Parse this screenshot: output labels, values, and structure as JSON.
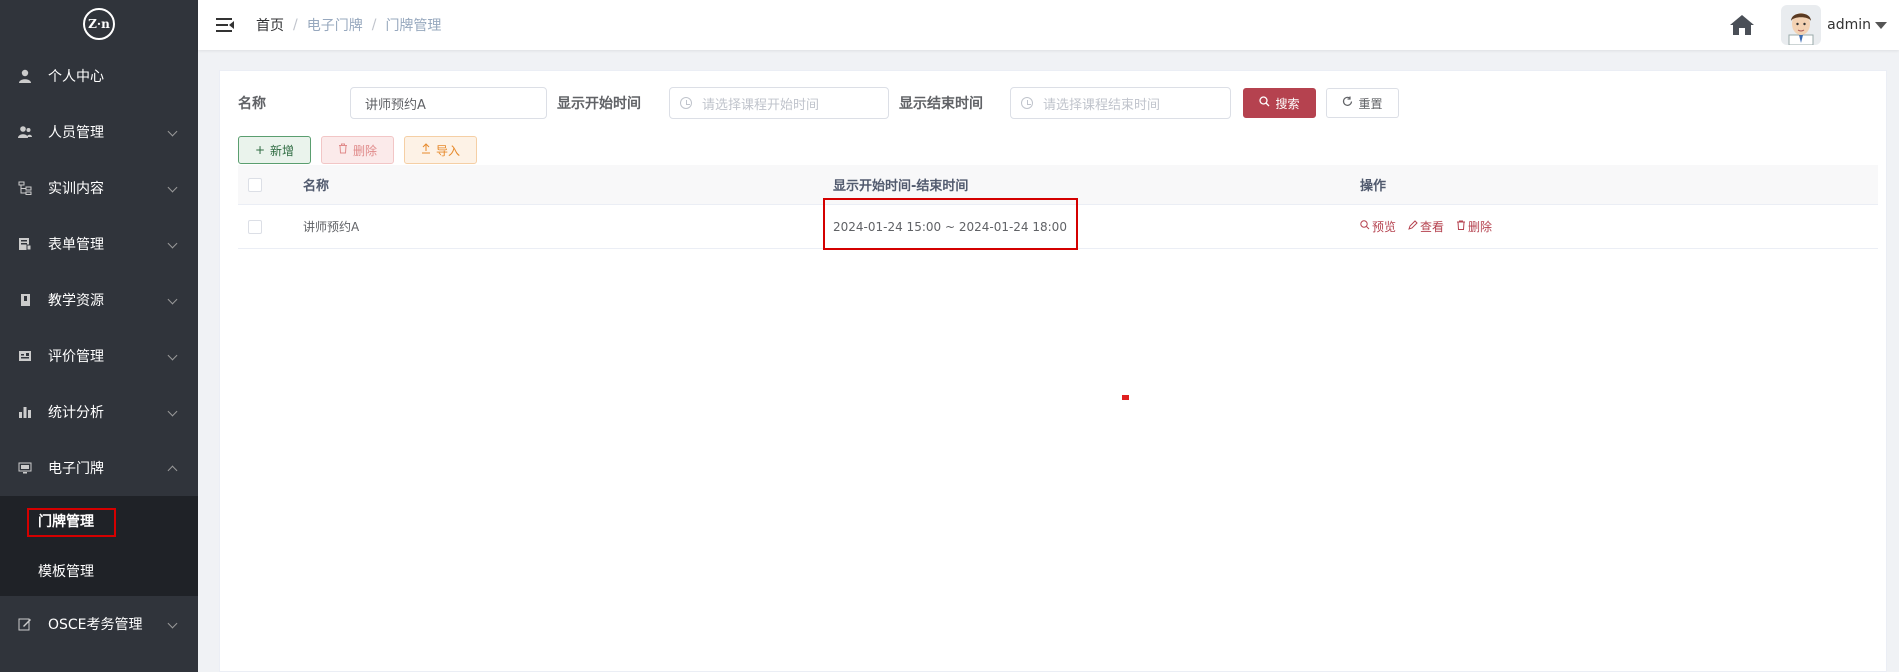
{
  "logo": {
    "text": "Z·n"
  },
  "sidebar": {
    "items": [
      {
        "label": "个人中心",
        "icon": "user-icon",
        "has_caret": false
      },
      {
        "label": "人员管理",
        "icon": "people-icon",
        "has_caret": true
      },
      {
        "label": "实训内容",
        "icon": "tree-icon",
        "has_caret": true
      },
      {
        "label": "表单管理",
        "icon": "form-icon",
        "has_caret": true
      },
      {
        "label": "教学资源",
        "icon": "book-icon",
        "has_caret": true
      },
      {
        "label": "评价管理",
        "icon": "evaluate-icon",
        "has_caret": true
      },
      {
        "label": "统计分析",
        "icon": "bar-chart-icon",
        "has_caret": true
      },
      {
        "label": "电子门牌",
        "icon": "monitor-icon",
        "has_caret": true,
        "open": true
      }
    ],
    "submenu": [
      {
        "label": "门牌管理",
        "active": true
      },
      {
        "label": "模板管理",
        "active": false
      }
    ],
    "after_items": [
      {
        "label": "OSCE考务管理",
        "icon": "edit-icon",
        "has_caret": true
      }
    ]
  },
  "header": {
    "breadcrumb": [
      "首页",
      "电子门牌",
      "门牌管理"
    ],
    "username": "admin"
  },
  "search": {
    "name_label": "名称",
    "name_value": "讲师预约A",
    "start_label": "显示开始时间",
    "start_placeholder": "请选择课程开始时间",
    "end_label": "显示结束时间",
    "end_placeholder": "请选择课程结束时间",
    "search_btn": "搜索",
    "reset_btn": "重置"
  },
  "toolbar": {
    "add_btn": "新增",
    "delete_btn": "删除",
    "import_btn": "导入"
  },
  "table": {
    "headers": [
      "名称",
      "显示开始时间-结束时间",
      "操作"
    ],
    "rows": [
      {
        "name": "讲师预约A",
        "time": "2024-01-24 15:00 ~ 2024-01-24 18:00",
        "ops": [
          "预览",
          "查看",
          "删除"
        ]
      }
    ]
  },
  "colors": {
    "sidebar_bg": "#30343b",
    "submenu_bg": "#1f2227",
    "primary": "#b5424f",
    "highlight": "#d40000"
  }
}
